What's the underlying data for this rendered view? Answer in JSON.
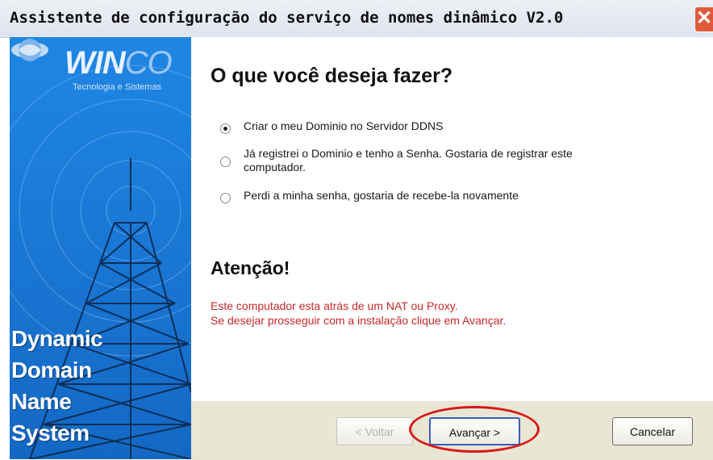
{
  "window": {
    "title": "Assistente de configuração do serviço de nomes dinâmico V2.0",
    "close_glyph": "✕"
  },
  "sidebar": {
    "logo_main": "WIN",
    "logo_co": "CO",
    "logo_sub": "Tecnologia e Sistemas",
    "lines": [
      "Dynamic",
      "Domain",
      "Name",
      "System"
    ]
  },
  "main": {
    "heading": "O que você deseja fazer?",
    "options": [
      {
        "label": "Criar o meu Dominio no Servidor DDNS",
        "checked": true
      },
      {
        "label": "Já registrei o Dominio e tenho a Senha. Gostaria de registrar este computador.",
        "checked": false
      },
      {
        "label": "Perdi a minha senha, gostaria de recebe-la novamente",
        "checked": false
      }
    ],
    "attention_title": "Atenção!",
    "warning_line1": "Este computador esta atrás de um NAT ou Proxy.",
    "warning_line2": "Se desejar prosseguir com a instalação clique em Avançar."
  },
  "footer": {
    "back_label": "< Voltar",
    "next_label": "Avançar >",
    "cancel_label": "Cancelar"
  },
  "colors": {
    "sidebar_blue": "#1a7bd8",
    "warning_red": "#c8282a",
    "highlight_red": "#d81818",
    "footer_bg": "#e9e6d4"
  },
  "icons": [
    "winco-logo-icon",
    "radio-tower-icon",
    "close-icon"
  ]
}
